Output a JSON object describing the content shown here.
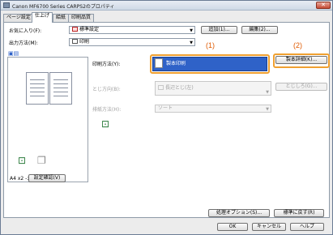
{
  "window": {
    "title": "Canon MF6700 Series CARPS2のプロパティ",
    "close_glyph": "✕"
  },
  "tabs": [
    {
      "label": "ページ設定"
    },
    {
      "label": "仕上げ"
    },
    {
      "label": "給紙"
    },
    {
      "label": "印刷品質"
    }
  ],
  "favorites": {
    "label": "お気に入り(F):",
    "value": "標準設定",
    "add_label": "追加(1)...",
    "edit_label": "編集(2)..."
  },
  "output": {
    "label": "出力方法(M):",
    "value": "印刷"
  },
  "preview": {
    "caption": "A4 x2 -> A4",
    "settings_button": "設定確認(V)"
  },
  "print_method": {
    "label": "印刷方法(Y):",
    "value": "製本印刷",
    "details_button": "製本詳細(K)..."
  },
  "binding": {
    "label": "とじ方向(B):",
    "value": "長辺とじ(左)",
    "margin_button": "とじしろ(G)..."
  },
  "discharge": {
    "label": "排紙方法(H):",
    "value": "ソート"
  },
  "callouts": {
    "one": "(1)",
    "two": "(2)"
  },
  "bottom": {
    "processing_options": "処理オプション(S)...",
    "restore_defaults": "標準に戻す(R)"
  },
  "dialog": {
    "ok": "OK",
    "cancel": "キャンセル",
    "help": "ヘルプ"
  },
  "colors": {
    "accent": "#2f62c8",
    "callout": "#e05a00",
    "highlight": "#f0a030"
  }
}
